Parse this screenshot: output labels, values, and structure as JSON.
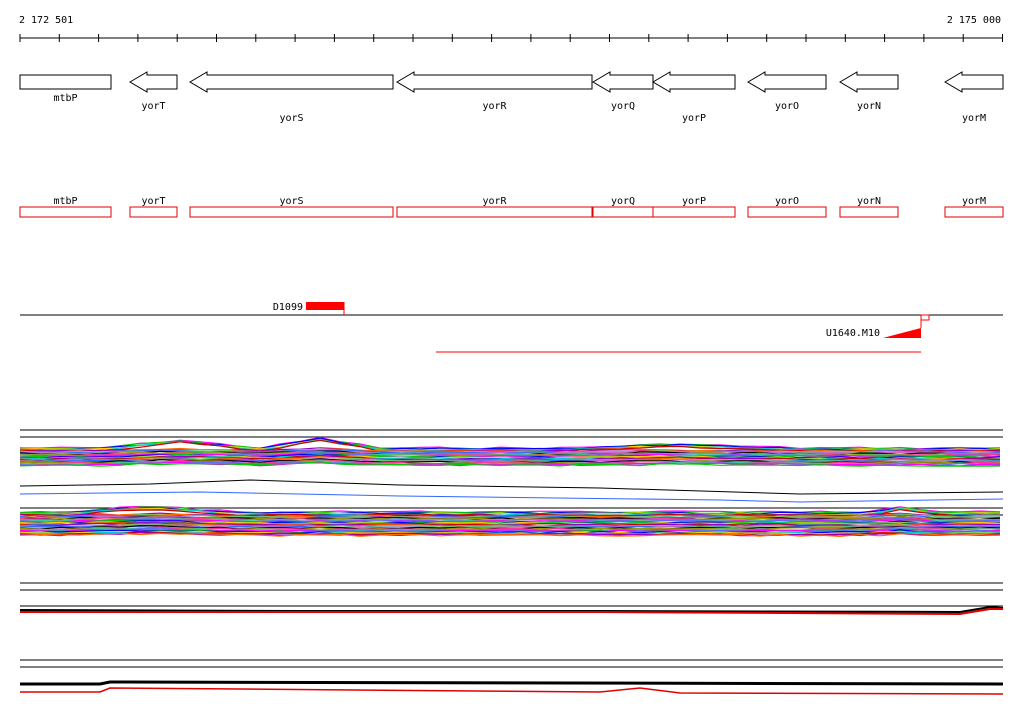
{
  "browser": {
    "coord_start": "2 172 501",
    "coord_end": "2 175 000"
  },
  "genes": [
    {
      "name": "mtbP",
      "strand": "+"
    },
    {
      "name": "yorT",
      "strand": "-"
    },
    {
      "name": "yorS",
      "strand": "-"
    },
    {
      "name": "yorR",
      "strand": "-"
    },
    {
      "name": "yorQ",
      "strand": "-"
    },
    {
      "name": "yorP",
      "strand": "-"
    },
    {
      "name": "yorO",
      "strand": "-"
    },
    {
      "name": "yorN",
      "strand": "-"
    },
    {
      "name": "yorM",
      "strand": "-"
    }
  ],
  "features": [
    {
      "label": "D1099"
    },
    {
      "label": "U1640.M10"
    }
  ],
  "colors": {
    "gene_outline": "#000000",
    "gene_box_red": "#e00000",
    "feature_red": "#ff0000",
    "axis": "#000000",
    "palette": [
      "#ff00ff",
      "#00cc00",
      "#0000ff",
      "#ffcc00",
      "#00cccc",
      "#cc0000",
      "#9900cc",
      "#ff6600",
      "#66cc66",
      "#3366ff",
      "#cc66cc",
      "#000000",
      "#999900",
      "#ff3399",
      "#33cc99",
      "#6666ff"
    ]
  }
}
